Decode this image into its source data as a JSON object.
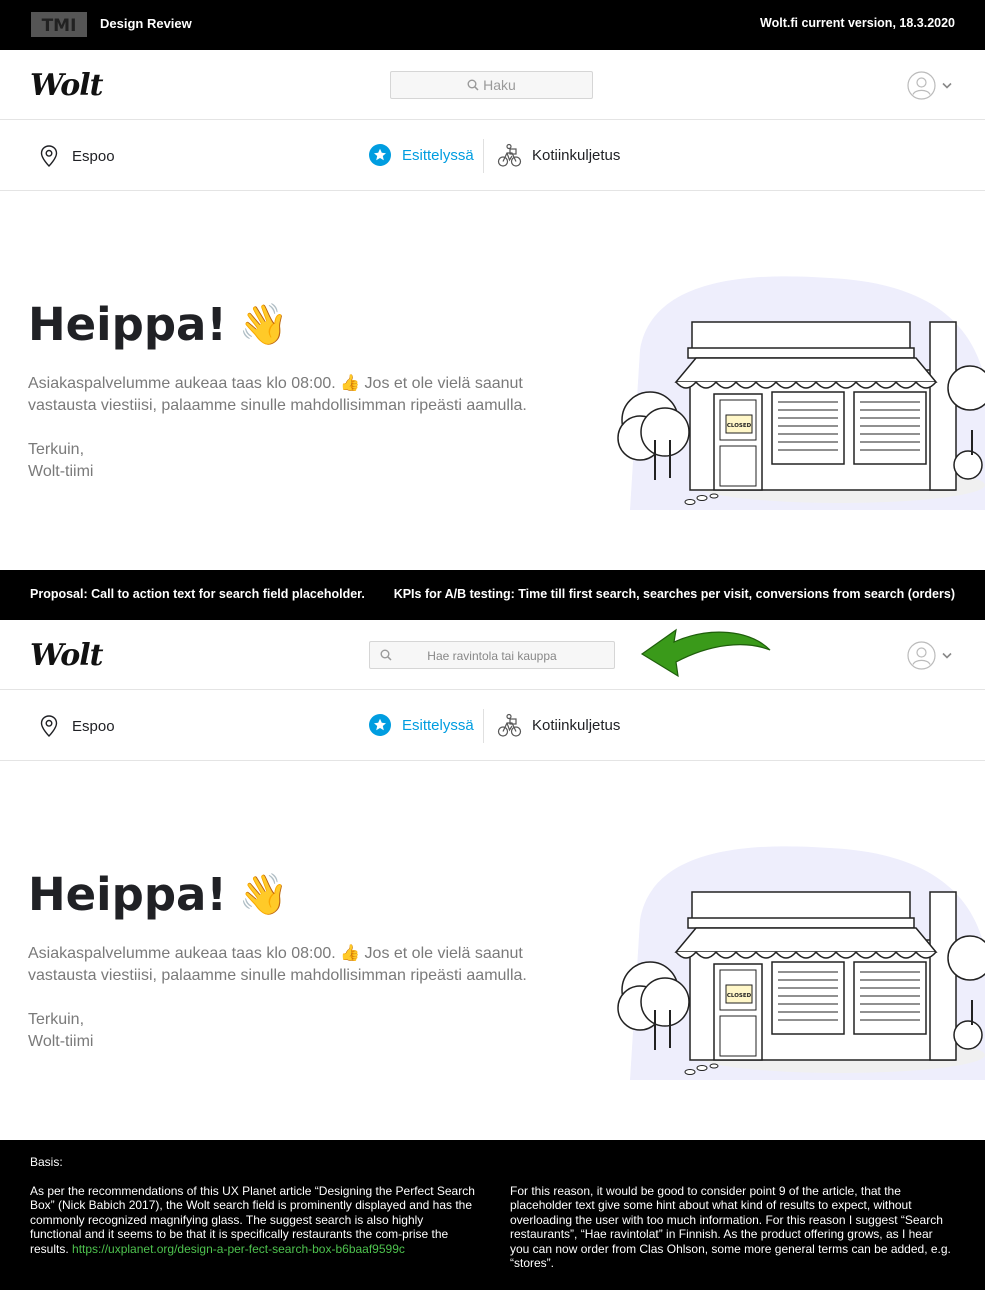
{
  "topbar": {
    "logo_text": "TMI",
    "title": "Design Review",
    "version": "Wolt.fi current version, 18.3.2020"
  },
  "brand": {
    "name": "Wolt",
    "accent": "#009de0"
  },
  "current": {
    "search_placeholder": "Haku",
    "nav": {
      "location": "Espoo",
      "featured": "Esittelyssä",
      "delivery": "Kotiinkuljetus"
    },
    "hero": {
      "title": "Heippa!",
      "emoji": "👋",
      "message": "Asiakaspalvelumme aukeaa taas klo 08:00. 👍 Jos et ole vielä saanut vastausta viestiisi, palaamme sinulle mahdollisimman ripeästi aamulla.",
      "sign1": "Terkuin,",
      "sign2": "Wolt-tiimi"
    },
    "closed_sign": "CLOSED"
  },
  "proposal_bar": {
    "left": "Proposal: Call to action text for search field placeholder.",
    "right": "KPIs  for A/B testing:  Time till first search, searches per visit, conversions from search (orders)"
  },
  "proposal": {
    "search_placeholder": "Hae ravintola tai kauppa",
    "nav": {
      "location": "Espoo",
      "featured": "Esittelyssä",
      "delivery": "Kotiinkuljetus"
    },
    "hero": {
      "title": "Heippa!",
      "emoji": "👋",
      "message": "Asiakaspalvelumme aukeaa taas klo 08:00. 👍 Jos et ole vielä saanut vastausta viestiisi, palaamme sinulle mahdollisimman ripeästi aamulla.",
      "sign1": "Terkuin,",
      "sign2": "Wolt-tiimi"
    },
    "closed_sign": "CLOSED"
  },
  "footer": {
    "basis": "Basis:",
    "col1_text": "As per the recommendations of this UX Planet article “Designing the Perfect Search Box” (Nick Babich 2017), the Wolt search field is prominently displayed and has the commonly recognized magnifying glass. The suggest search is also highly functional and it seems to be that it is specifically restaurants the com-prise the results. ",
    "col1_link": "https://uxplanet.org/design-a-per-fect-search-box-b6baaf9599c",
    "col2_text": "For this reason, it would be good to consider point 9 of the article, that the placeholder text give some hint about what kind of results to expect, without overloading the user with too much information.  For this reason I suggest “Search restaurants”, “Hae ravintolat” in Finnish. As the product offering grows, as I hear you can now order from Clas Ohlson, some more general terms can be added,  e.g. “stores”."
  },
  "icons": {
    "search": "magnifier-icon",
    "profile": "user-avatar-icon",
    "chevron": "chevron-down-icon",
    "location": "location-pin-icon",
    "featured": "star-badge-icon",
    "delivery": "courier-bike-icon",
    "arrow": "green-arrow-icon"
  },
  "colors": {
    "arrow": "#3a9a1a",
    "link": "#4ec24e",
    "blob": "#eeeefc"
  }
}
